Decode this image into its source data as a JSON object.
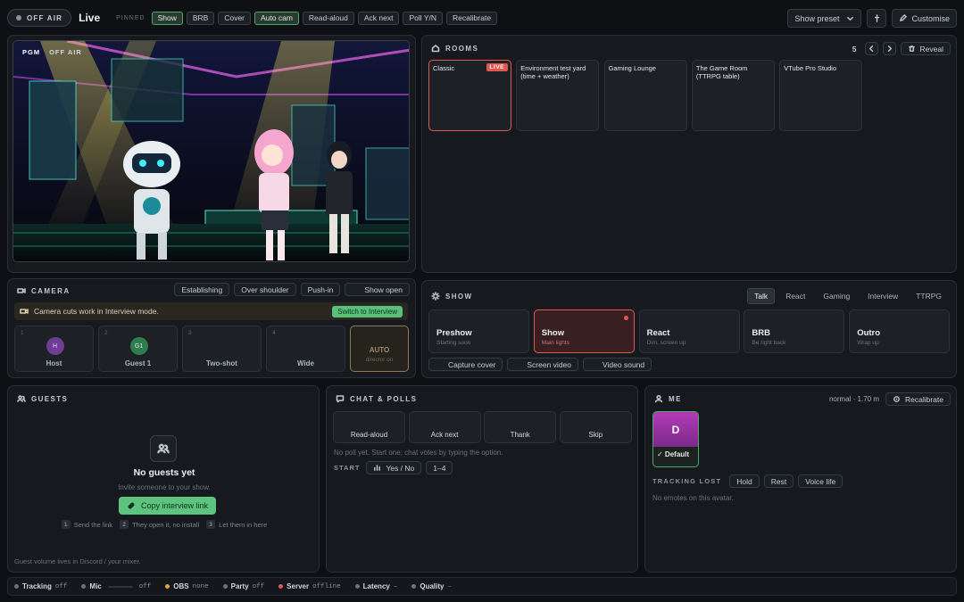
{
  "topbar": {
    "air_status": "OFF AIR",
    "live_label": "Live",
    "pinned_label": "PINNED",
    "pinned": [
      {
        "label": "Show",
        "active": true
      },
      {
        "label": "BRB",
        "active": false
      },
      {
        "label": "Cover",
        "active": false
      },
      {
        "label": "Auto cam",
        "active": true
      },
      {
        "label": "Read-aloud",
        "active": false
      },
      {
        "label": "Ack next",
        "active": false
      },
      {
        "label": "Poll Y/N",
        "active": false
      },
      {
        "label": "Recalibrate",
        "active": false
      }
    ],
    "show_preset": "Show preset",
    "customise": "Customise"
  },
  "program": {
    "pgm_label": "PGM",
    "air_label": "OFF AIR"
  },
  "rooms": {
    "title": "ROOMS",
    "count": "5",
    "reveal": "Reveal",
    "live_badge": "LIVE",
    "items": [
      {
        "name": "Classic"
      },
      {
        "name": "Environment test yard (time + weather)"
      },
      {
        "name": "Gaming Lounge"
      },
      {
        "name": "The Game Room (TTRPG table)"
      },
      {
        "name": "VTube Pro Studio"
      }
    ]
  },
  "camera": {
    "title": "CAMERA",
    "moves": [
      "Establishing",
      "Over shoulder",
      "Push-in"
    ],
    "show_open": "Show open",
    "notice": "Camera cuts work in Interview mode.",
    "switch_label": "Switch to Interview",
    "shots": [
      {
        "num": "1",
        "label": "Host",
        "avatar": "H"
      },
      {
        "num": "2",
        "label": "Guest 1",
        "avatar": "G1"
      },
      {
        "num": "3",
        "label": "Two-shot"
      },
      {
        "num": "4",
        "label": "Wide"
      },
      {
        "num": "",
        "label": "AUTO",
        "sub": "director on"
      }
    ]
  },
  "show": {
    "title": "SHOW",
    "tabs": [
      {
        "label": "Talk",
        "active": true
      },
      {
        "label": "React",
        "active": false
      },
      {
        "label": "Gaming",
        "active": false
      },
      {
        "label": "Interview",
        "active": false
      },
      {
        "label": "TTRPG",
        "active": false
      }
    ],
    "scenes": [
      {
        "title": "Preshow",
        "sub": "Starting soon",
        "icon": "timer-icon"
      },
      {
        "title": "Show",
        "sub": "Main lights",
        "icon": "sun-icon",
        "active": true
      },
      {
        "title": "React",
        "sub": "Dim, screen up",
        "icon": "bolt-icon"
      },
      {
        "title": "BRB",
        "sub": "Be right back",
        "icon": "coffee-icon"
      },
      {
        "title": "Outro",
        "sub": "Wrap up",
        "icon": "flag-icon"
      }
    ],
    "actions": [
      "Capture cover",
      "Screen video",
      "Video sound"
    ]
  },
  "guests": {
    "title": "GUESTS",
    "empty_title": "No guests yet",
    "empty_sub": "Invite someone to your show.",
    "copy_link": "Copy interview link",
    "steps": [
      {
        "n": "1",
        "text": "Send the link"
      },
      {
        "n": "2",
        "text": "They open it, no install"
      },
      {
        "n": "3",
        "text": "Let them in here"
      }
    ],
    "footer": "Guest volume lives in Discord / your mixer."
  },
  "chat": {
    "title": "CHAT & POLLS",
    "actions": [
      {
        "label": "Read-aloud",
        "icon": "speaker-icon"
      },
      {
        "label": "Ack next",
        "icon": "check-icon"
      },
      {
        "label": "Thank",
        "icon": "heart-icon"
      },
      {
        "label": "Skip",
        "icon": "skip-icon"
      }
    ],
    "poll_note": "No poll yet. Start one; chat votes by typing the option.",
    "start_label": "START",
    "polls": [
      "Yes / No",
      "1–4"
    ]
  },
  "me": {
    "title": "ME",
    "readout": "normal · 1.70 m",
    "recalibrate": "Recalibrate",
    "avatar_letter": "D",
    "avatar_label": "✓ Default",
    "tracking_lost": "TRACKING LOST",
    "poses": [
      "Hold",
      "Rest",
      "Voice life"
    ],
    "emotes_note": "No emotes on this avatar."
  },
  "status": [
    {
      "label": "Tracking",
      "value": "off",
      "color": "#6c737c"
    },
    {
      "label": "Mic",
      "value": "off",
      "color": "#6c737c",
      "meter": true
    },
    {
      "label": "OBS",
      "value": "none",
      "color": "#e8a23a"
    },
    {
      "label": "Party",
      "value": "off",
      "color": "#6c737c"
    },
    {
      "label": "Server",
      "value": "offline",
      "color": "#e2584f"
    },
    {
      "label": "Latency",
      "value": "–",
      "color": "#6c737c"
    },
    {
      "label": "Quality",
      "value": "–",
      "color": "#6c737c"
    }
  ],
  "colors": {
    "accent_green": "#4fa56b",
    "live_red": "#e2584f",
    "obs_orange": "#e8a23a"
  }
}
